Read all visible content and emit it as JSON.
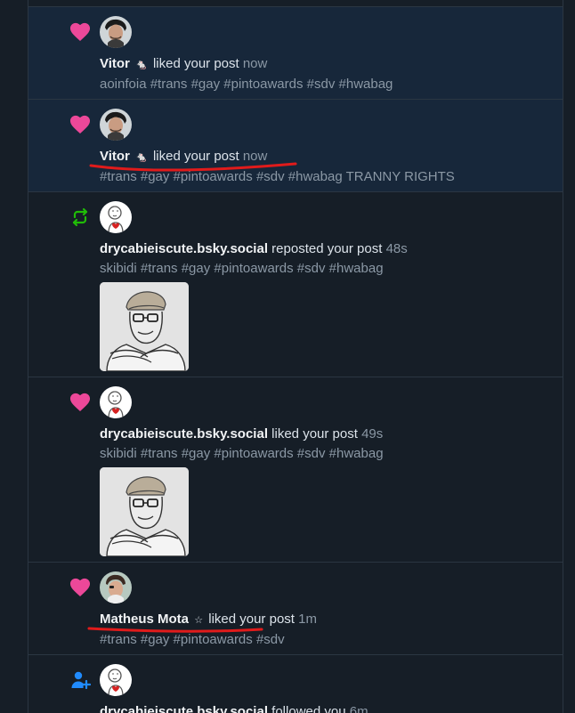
{
  "colors": {
    "background": "#161e27",
    "unread_background": "#17273a",
    "like": "#ec4899",
    "repost": "#20bc07",
    "follow": "#208bfe",
    "annotation": "#e01b1b"
  },
  "notifications": [
    {
      "type": "like",
      "icon": "heart-icon",
      "unread": true,
      "author": "Vitor",
      "badge": "🐁",
      "action": "liked your post",
      "time": "now",
      "post_text": "aoinfoia #trans #gay #pintoawards #sdv #hwabag"
    },
    {
      "type": "like",
      "icon": "heart-icon",
      "unread": true,
      "author": "Vitor",
      "badge": "🐁",
      "action": "liked your post",
      "time": "now",
      "post_text": "#trans #gay #pintoawards #sdv #hwabag TRANNY RIGHTS"
    },
    {
      "type": "repost",
      "icon": "repost-icon",
      "unread": false,
      "author": "drycabieiscute.bsky.social",
      "action": "reposted your post",
      "time": "48s",
      "post_text": "skibidi #trans #gay #pintoawards #sdv #hwabag"
    },
    {
      "type": "like",
      "icon": "heart-icon",
      "unread": false,
      "author": "drycabieiscute.bsky.social",
      "action": "liked your post",
      "time": "49s",
      "post_text": "skibidi #trans #gay #pintoawards #sdv #hwabag"
    },
    {
      "type": "like",
      "icon": "heart-icon",
      "unread": false,
      "author": "Matheus Mota",
      "badge": "☆",
      "action": "liked your post",
      "time": "1m",
      "post_text": "#trans #gay #pintoawards #sdv"
    },
    {
      "type": "follow",
      "icon": "person-add-icon",
      "unread": false,
      "author": "drycabieiscute.bsky.social",
      "action": "followed you",
      "time": "6m"
    }
  ]
}
